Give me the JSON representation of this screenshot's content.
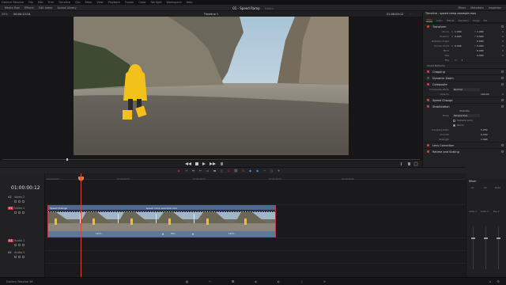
{
  "menu": [
    "DaVinci Resolve",
    "File",
    "Edit",
    "Trim",
    "Timeline",
    "Clip",
    "Mark",
    "View",
    "Playback",
    "Fusion",
    "Color",
    "Fairlight",
    "Workspace",
    "Help"
  ],
  "toolbar": {
    "left": [
      "Media Pool",
      "Effects",
      "Edit Index",
      "Sound Library"
    ],
    "project_title": "01 - Speed Ramp",
    "edited_label": "Edited",
    "right": [
      "Mixer",
      "Metadata",
      "Inspector"
    ]
  },
  "viewer": {
    "zoom": "25%",
    "source_timecode": "00:00:10:14",
    "timeline_name": "Timeline 1",
    "record_timecode": "01:00:00:12"
  },
  "transport": {
    "left_tc": "",
    "right_tc": ""
  },
  "inspector": {
    "title": "Timeline - speed ramp example.mov",
    "tabs": [
      {
        "label": "Video",
        "active": true
      },
      {
        "label": "Audio",
        "active": false
      },
      {
        "label": "Effects",
        "active": false
      },
      {
        "label": "Transition",
        "active": false
      },
      {
        "label": "Image",
        "active": false
      },
      {
        "label": "File",
        "active": false
      }
    ],
    "transform": {
      "label": "Transform",
      "zoom_label": "Zoom",
      "zoom_x_label": "X",
      "zoom_x": "1.000",
      "zoom_y_label": "Y",
      "zoom_y": "1.000",
      "position_label": "Position",
      "pos_x_label": "X",
      "pos_x": "0.000",
      "pos_y_label": "Y",
      "pos_y": "0.000",
      "rotation_label": "Rotation Angle",
      "rotation": "0.000",
      "anchor_label": "Anchor Point",
      "anchor_x_label": "X",
      "anchor_x": "0.000",
      "anchor_y_label": "Y",
      "anchor_y": "0.000",
      "pitch_label": "Pitch",
      "pitch": "0.000",
      "yaw_label": "Yaw",
      "yaw": "0.000",
      "flip_label": "Flip"
    },
    "smart_reframe": "Smart Reframe",
    "cropping": "Cropping",
    "dynamic_zoom": "Dynamic Zoom",
    "composite": {
      "label": "Composite",
      "mode_label": "Composite Mode",
      "mode_value": "Normal",
      "opacity_label": "Opacity",
      "opacity_value": "100.00"
    },
    "speed_change": "Speed Change",
    "stabilization": {
      "label": "Stabilization",
      "button": "Stabilize",
      "mode_label": "Mode",
      "mode_value": "Perspective",
      "camera_lock": "Camera Lock",
      "zoom": "Zoom",
      "cropping_ratio_label": "Cropping Ratio",
      "cropping_ratio": "0.250",
      "smooth_label": "Smooth",
      "smooth": "0.250",
      "strength_label": "Strength",
      "strength": "1.000"
    },
    "lens_correction": "Lens Correction",
    "retime_scaling": "Retime and Scaling"
  },
  "timeline": {
    "timecode": "01:00:00:12",
    "ruler": [
      "01:00:00:00",
      "01:00:05:00",
      "01:00:10:00",
      "01:00:15:00",
      "01:00:20:00"
    ],
    "tracks": [
      {
        "id": "V2",
        "name": "Video 2"
      },
      {
        "id": "V1",
        "name": "Video 1"
      },
      {
        "id": "A1",
        "name": "Audio 1"
      },
      {
        "id": "A2",
        "name": "Audio 2"
      }
    ],
    "clip": {
      "speed_change_label": "Speed Change",
      "name": "speed ramp example.mov",
      "speeds": [
        "100%",
        "50%",
        "100%",
        "100%"
      ]
    }
  },
  "mixer": {
    "title": "Mixer",
    "channels": [
      "A1",
      "A2",
      "Bus1"
    ],
    "bus_labels": [
      "Audio 1",
      "Audio 2",
      "Bus 1"
    ]
  },
  "statusbar": {
    "app_name": "DaVinci Resolve 18",
    "pages": [
      {
        "name": "media-page",
        "active": false
      },
      {
        "name": "cut-page",
        "active": false
      },
      {
        "name": "edit-page",
        "active": true
      },
      {
        "name": "fusion-page",
        "active": false
      },
      {
        "name": "color-page",
        "active": false
      },
      {
        "name": "fairlight-page",
        "active": false
      },
      {
        "name": "deliver-page",
        "active": false
      }
    ]
  },
  "colors": {
    "accent_red": "#d8483b",
    "playhead_orange": "#e07a2e",
    "clip_blue": "#6a86a8",
    "timeline_blue_icon": "#3d8fe8"
  }
}
